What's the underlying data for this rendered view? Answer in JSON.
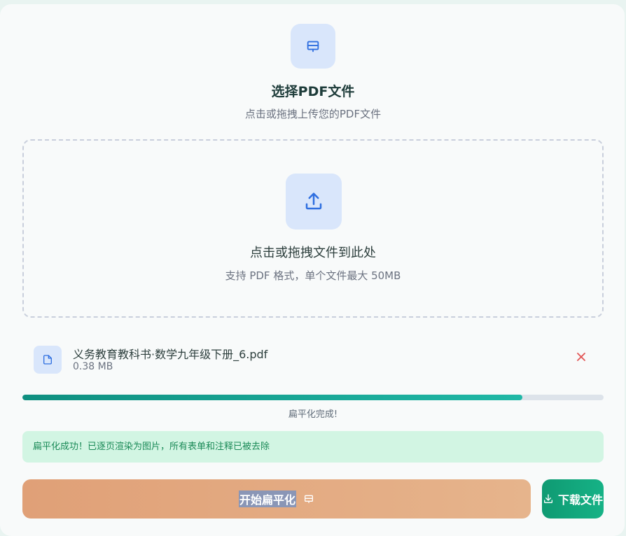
{
  "header": {
    "icon": "flatten-icon",
    "title": "选择PDF文件",
    "subtitle": "点击或拖拽上传您的PDF文件"
  },
  "dropzone": {
    "icon": "upload-icon",
    "title": "点击或拖拽文件到此处",
    "hint": "支持 PDF 格式，单个文件最大 50MB"
  },
  "file": {
    "icon": "document-icon",
    "name": "义务教育教科书·数学九年级下册_6.pdf",
    "size": "0.38 MB",
    "remove_icon": "close-icon"
  },
  "progress": {
    "value": 0.86,
    "status_text": "扁平化完成!"
  },
  "success_message": "扁平化成功！已逐页渲染为图片，所有表单和注释已被去除",
  "actions": {
    "start_label": "开始扁平化",
    "start_icon": "flatten-icon",
    "download_label": "下载文件",
    "download_icon": "download-icon"
  },
  "colors": {
    "accent_blue": "#2f6fe0",
    "success_green": "#1a8a57",
    "progress_teal": "#0f8f80",
    "danger_red": "#e25555"
  }
}
